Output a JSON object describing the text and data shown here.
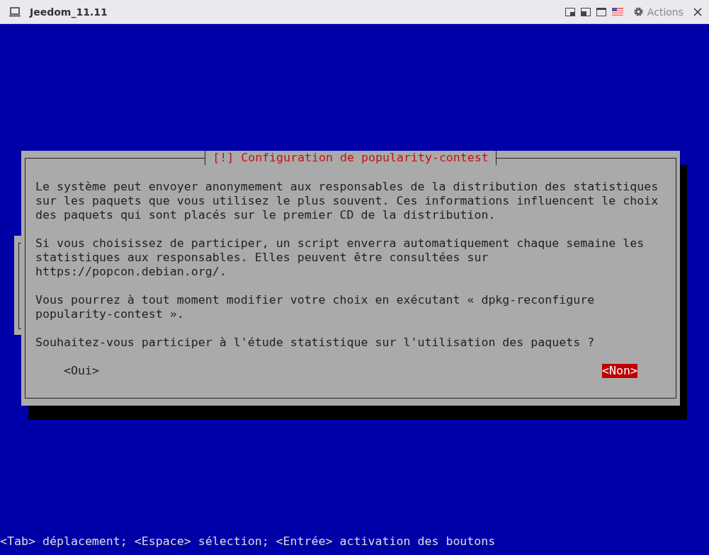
{
  "window": {
    "title": "Jeedom_11.11",
    "actions": "Actions"
  },
  "dialog": {
    "title": "[!] Configuration de popularity-contest",
    "paragraphs": [
      [
        "Le système peut envoyer anonymement aux responsables de la distribution des statistiques",
        "sur les paquets que vous utilisez le plus souvent. Ces informations influencent le choix",
        "des paquets qui sont placés sur le premier CD de la distribution."
      ],
      [
        "Si vous choisissez de participer, un script enverra automatiquement chaque semaine les",
        "statistiques aux responsables. Elles peuvent être consultées sur",
        "https://popcon.debian.org/."
      ],
      [
        "Vous pourrez à tout moment modifier votre choix en exécutant « dpkg-reconfigure",
        "popularity-contest »."
      ],
      [
        "Souhaitez-vous participer à l'étude statistique sur l'utilisation des paquets ?"
      ]
    ],
    "buttons": [
      {
        "label": "<Oui>",
        "selected": false
      },
      {
        "label": "<Non>",
        "selected": true
      }
    ]
  },
  "status_line": "<Tab> déplacement; <Espace> sélection; <Entrée> activation des boutons"
}
